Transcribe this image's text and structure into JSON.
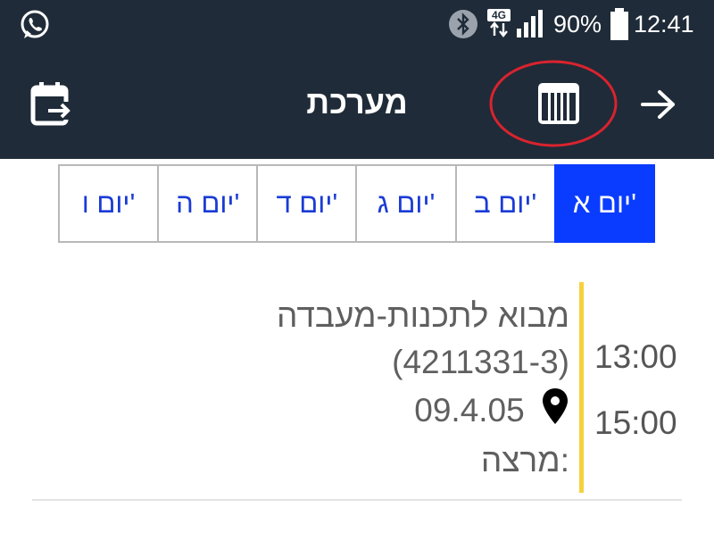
{
  "status_bar": {
    "network": "4G",
    "battery": "90%",
    "time": "12:41",
    "icons": [
      "whatsapp-icon",
      "bluetooth-icon",
      "signal-icon",
      "battery-icon"
    ]
  },
  "toolbar": {
    "title": "מערכת",
    "icons": [
      "calendar-export-icon",
      "week-grid-icon",
      "arrow-right-icon"
    ]
  },
  "day_tabs": [
    {
      "label": "יום א'",
      "active": true
    },
    {
      "label": "יום ב'",
      "active": false
    },
    {
      "label": "יום ג'",
      "active": false
    },
    {
      "label": "יום ד'",
      "active": false
    },
    {
      "label": "יום ה'",
      "active": false
    },
    {
      "label": "יום ו'",
      "active": false
    }
  ],
  "event": {
    "course_name": "מבוא לתכנות-מעבדה",
    "course_code": "(4211331-3)",
    "room": "09.4.05",
    "lecturer_label": "מרצה:",
    "start_time": "13:00",
    "end_time": "15:00"
  },
  "colors": {
    "header_bg": "#1f2b38",
    "active_tab": "#0a3cff",
    "tab_text": "#1a3bd6",
    "event_bar": "#f6d13c",
    "highlight_circle": "#d9232e"
  }
}
